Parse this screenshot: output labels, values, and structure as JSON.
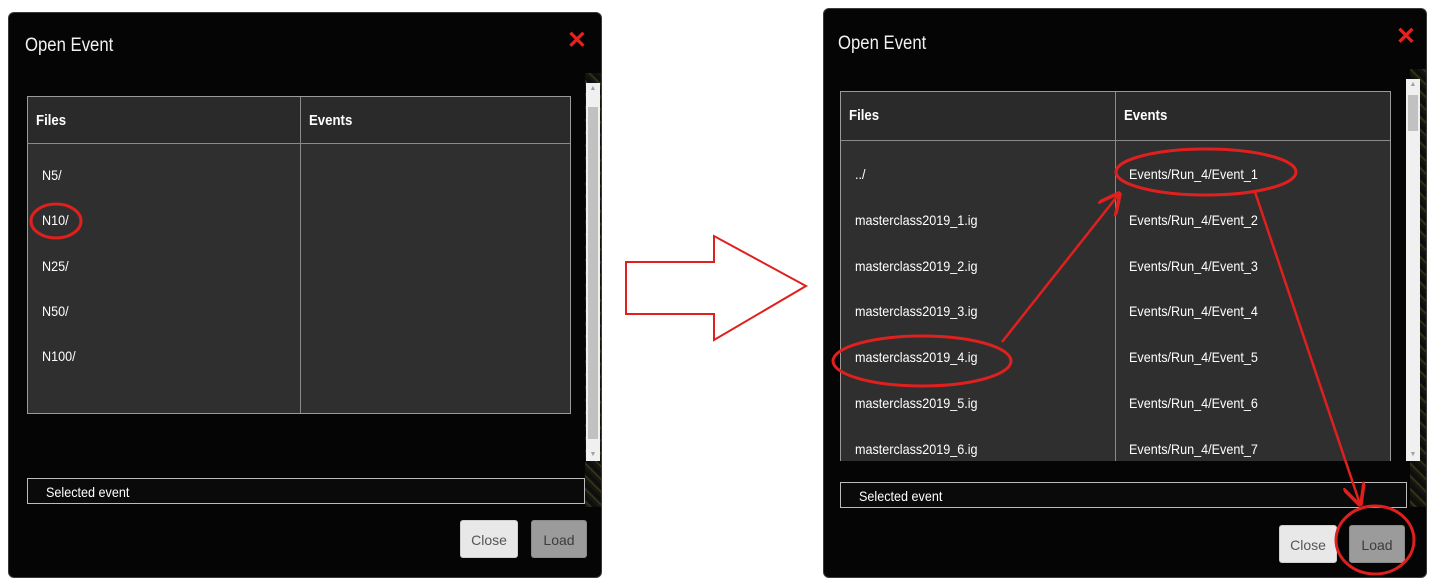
{
  "left_dialog": {
    "title": "Open Event",
    "close_icon": "✕",
    "columns": {
      "files": "Files",
      "events": "Events"
    },
    "files": [
      "N5/",
      "N10/",
      "N25/",
      "N50/",
      "N100/"
    ],
    "events": [],
    "selected_event_label": "Selected event",
    "buttons": {
      "close": "Close",
      "load": "Load"
    }
  },
  "right_dialog": {
    "title": "Open Event",
    "close_icon": "✕",
    "columns": {
      "files": "Files",
      "events": "Events"
    },
    "files": [
      "../",
      "masterclass2019_1.ig",
      "masterclass2019_2.ig",
      "masterclass2019_3.ig",
      "masterclass2019_4.ig",
      "masterclass2019_5.ig",
      "masterclass2019_6.ig"
    ],
    "events": [
      "Events/Run_4/Event_1",
      "Events/Run_4/Event_2",
      "Events/Run_4/Event_3",
      "Events/Run_4/Event_4",
      "Events/Run_4/Event_5",
      "Events/Run_4/Event_6",
      "Events/Run_4/Event_7"
    ],
    "selected_event_label": "Selected event",
    "buttons": {
      "close": "Close",
      "load": "Load"
    }
  },
  "annotations": {
    "highlight_color": "#e0201e",
    "arrow_icon": "outline-right-arrow-icon"
  }
}
